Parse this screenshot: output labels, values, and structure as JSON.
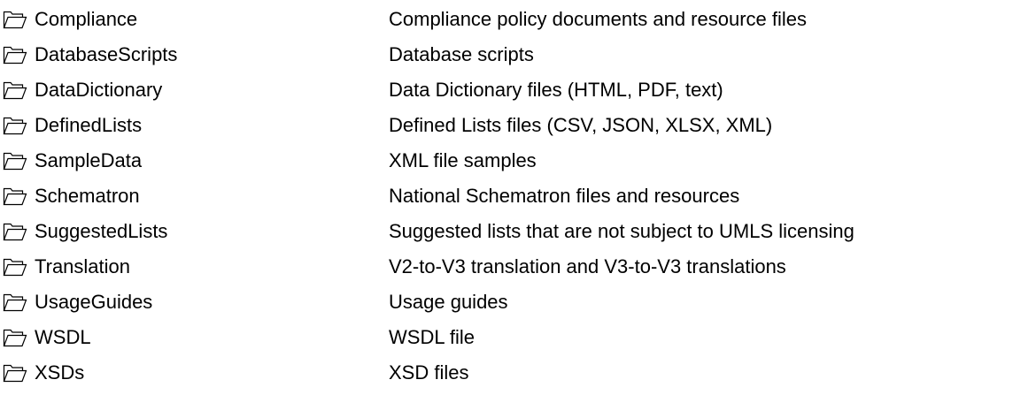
{
  "folders": [
    {
      "icon": "folder-open-icon",
      "name": "Compliance",
      "description": "Compliance policy documents and resource files"
    },
    {
      "icon": "folder-open-icon",
      "name": "DatabaseScripts",
      "description": "Database scripts"
    },
    {
      "icon": "folder-open-icon",
      "name": "DataDictionary",
      "description": "Data Dictionary files (HTML, PDF, text)"
    },
    {
      "icon": "folder-open-icon",
      "name": "DefinedLists",
      "description": "Defined Lists files (CSV, JSON, XLSX, XML)"
    },
    {
      "icon": "folder-open-icon",
      "name": "SampleData",
      "description": "XML file samples"
    },
    {
      "icon": "folder-open-icon",
      "name": "Schematron",
      "description": "National Schematron files and resources"
    },
    {
      "icon": "folder-open-icon",
      "name": "SuggestedLists",
      "description": "Suggested lists that are not subject to UMLS licensing"
    },
    {
      "icon": "folder-open-icon",
      "name": "Translation",
      "description": "V2-to-V3 translation and V3-to-V3 translations"
    },
    {
      "icon": "folder-open-icon",
      "name": "UsageGuides",
      "description": "Usage guides"
    },
    {
      "icon": "folder-open-icon",
      "name": "WSDL",
      "description": "WSDL file"
    },
    {
      "icon": "folder-open-icon",
      "name": "XSDs",
      "description": "XSD files"
    }
  ],
  "colors": {
    "text": "#000000",
    "background": "#ffffff",
    "icon_stroke": "#000000"
  }
}
